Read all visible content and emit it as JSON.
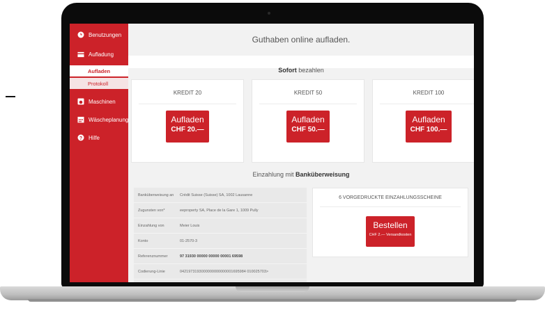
{
  "sidebar": {
    "items": [
      {
        "label": "Benutzungen",
        "icon": "clock-icon"
      },
      {
        "label": "Aufladung",
        "icon": "card-icon"
      },
      {
        "label": "Maschinen",
        "icon": "washer-icon"
      },
      {
        "label": "Wäscheplanung",
        "icon": "calendar-icon"
      },
      {
        "label": "Hilfe",
        "icon": "help-icon"
      }
    ],
    "subitems": [
      {
        "label": "Aufladen",
        "active": true
      },
      {
        "label": "Protokoll",
        "active": false
      }
    ]
  },
  "main": {
    "title": "Guthaben online aufladen.",
    "sofort_bold": "Sofort",
    "sofort_rest": " bezahlen",
    "cards": [
      {
        "label": "KREDIT 20",
        "button_line1": "Aufladen",
        "button_line2": "CHF 20.—"
      },
      {
        "label": "KREDIT 50",
        "button_line1": "Aufladen",
        "button_line2": "CHF 50.—"
      },
      {
        "label": "KREDIT 100",
        "button_line1": "Aufladen",
        "button_line2": "CHF 100.—"
      }
    ],
    "bank_head_prefix": "Einzahlung mit ",
    "bank_head_bold": "Banküberweisung",
    "bank_rows": [
      {
        "key": "Banküberweisung an",
        "value": "Crédit Suisse (Suisse) SA, 1002 Lausanne"
      },
      {
        "key": "Zugunsten von*",
        "value": "eeproperty SA, Place de la Gare 1, 1009 Pully"
      },
      {
        "key": "Einzahlung von",
        "value": "Meier Louis"
      },
      {
        "key": "Konto",
        "value": "01-2570-3"
      },
      {
        "key": "Referenznummer",
        "value": "97 31930 00000 00000 00001 69598"
      },
      {
        "key": "Codierung-Linie",
        "value": "0421973193000000000000001695984 010025703>"
      }
    ],
    "voucher": {
      "label": "6 VORGEDRUCKTE EINZAHLUNGSSCHEINE",
      "button_line1": "Bestellen",
      "button_line2": "CHF 2.— Versandkosten"
    }
  },
  "colors": {
    "brand": "#cc2229"
  }
}
